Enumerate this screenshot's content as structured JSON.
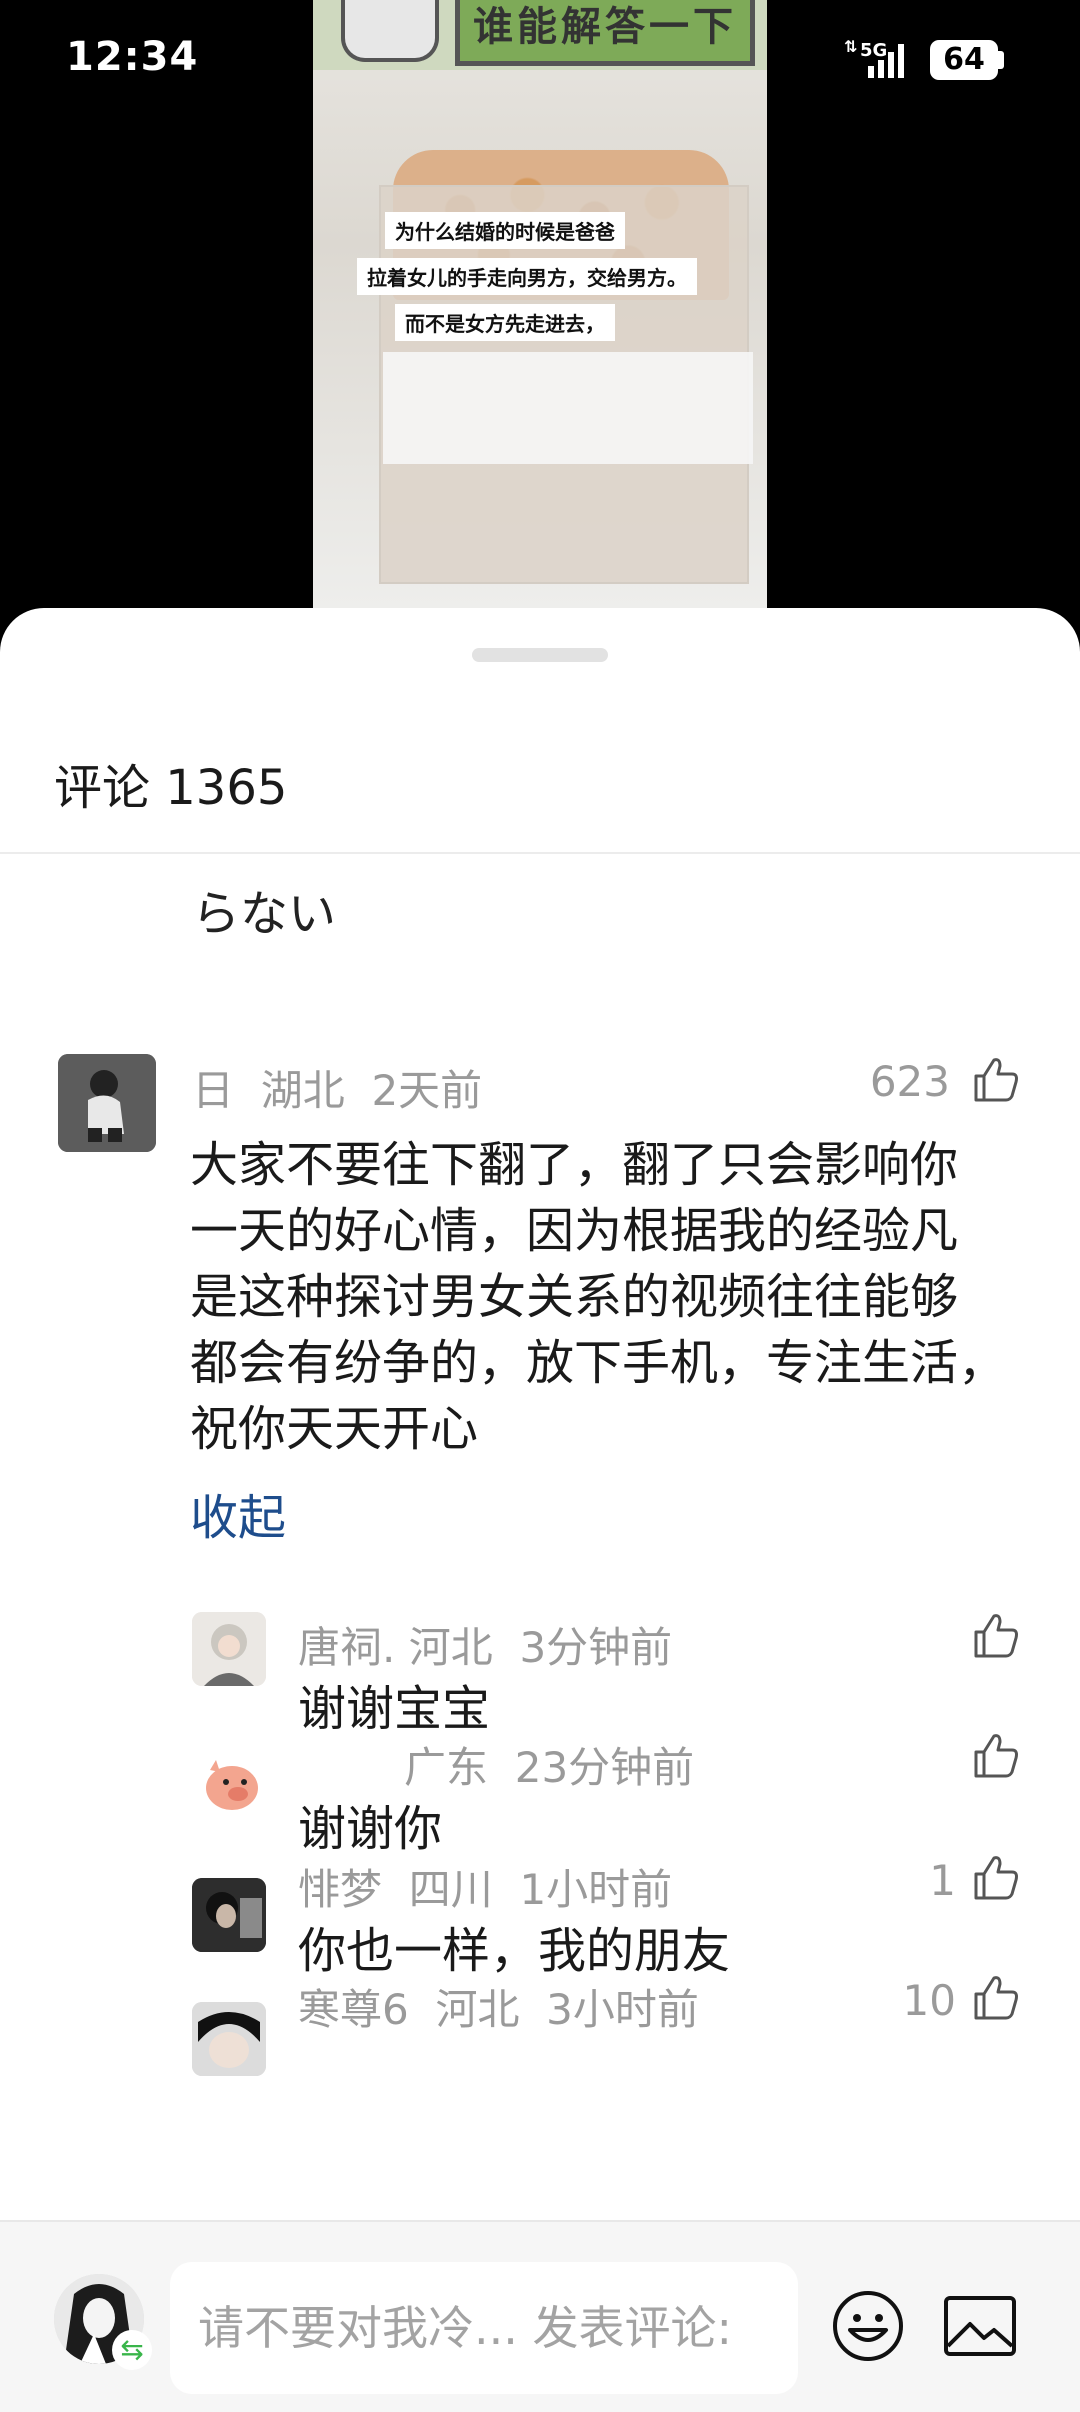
{
  "status": {
    "time": "12:34",
    "network": "5G",
    "battery": "64"
  },
  "video": {
    "banner": "谁能解答一下",
    "captions": [
      "为什么结婚的时候是爸爸",
      "拉着女儿的手走向男方，交给男方。",
      "而不是女方先走进去，"
    ]
  },
  "sheet": {
    "title": "评论 1365"
  },
  "partial_text": "らない",
  "comment": {
    "name": "日",
    "region": "湖北",
    "time": "2天前",
    "likes": "623",
    "lines": [
      "大家不要往下翻了，翻了只会影响你",
      "一天的好心情，因为根据我的经验凡",
      "是这种探讨男女关系的视频往往能够",
      "都会有纷争的，放下手机，专注生活，",
      "祝你天天开心"
    ],
    "collapse_label": "收起"
  },
  "replies": [
    {
      "name": "唐祠.",
      "region": "河北",
      "time": "3分钟前",
      "text": "谢谢宝宝",
      "likes": ""
    },
    {
      "name": "",
      "region": "广东",
      "time": "23分钟前",
      "text": "谢谢你",
      "likes": ""
    },
    {
      "name": "悱梦",
      "region": "四川",
      "time": "1小时前",
      "text": "你也一样，我的朋友",
      "likes": "1"
    },
    {
      "name": "寒尊6",
      "region": "河北",
      "time": "3小时前",
      "text": "",
      "likes": "10"
    }
  ],
  "composer": {
    "placeholder": "请不要对我冷... 发表评论:",
    "switch_icon": "⇆"
  }
}
